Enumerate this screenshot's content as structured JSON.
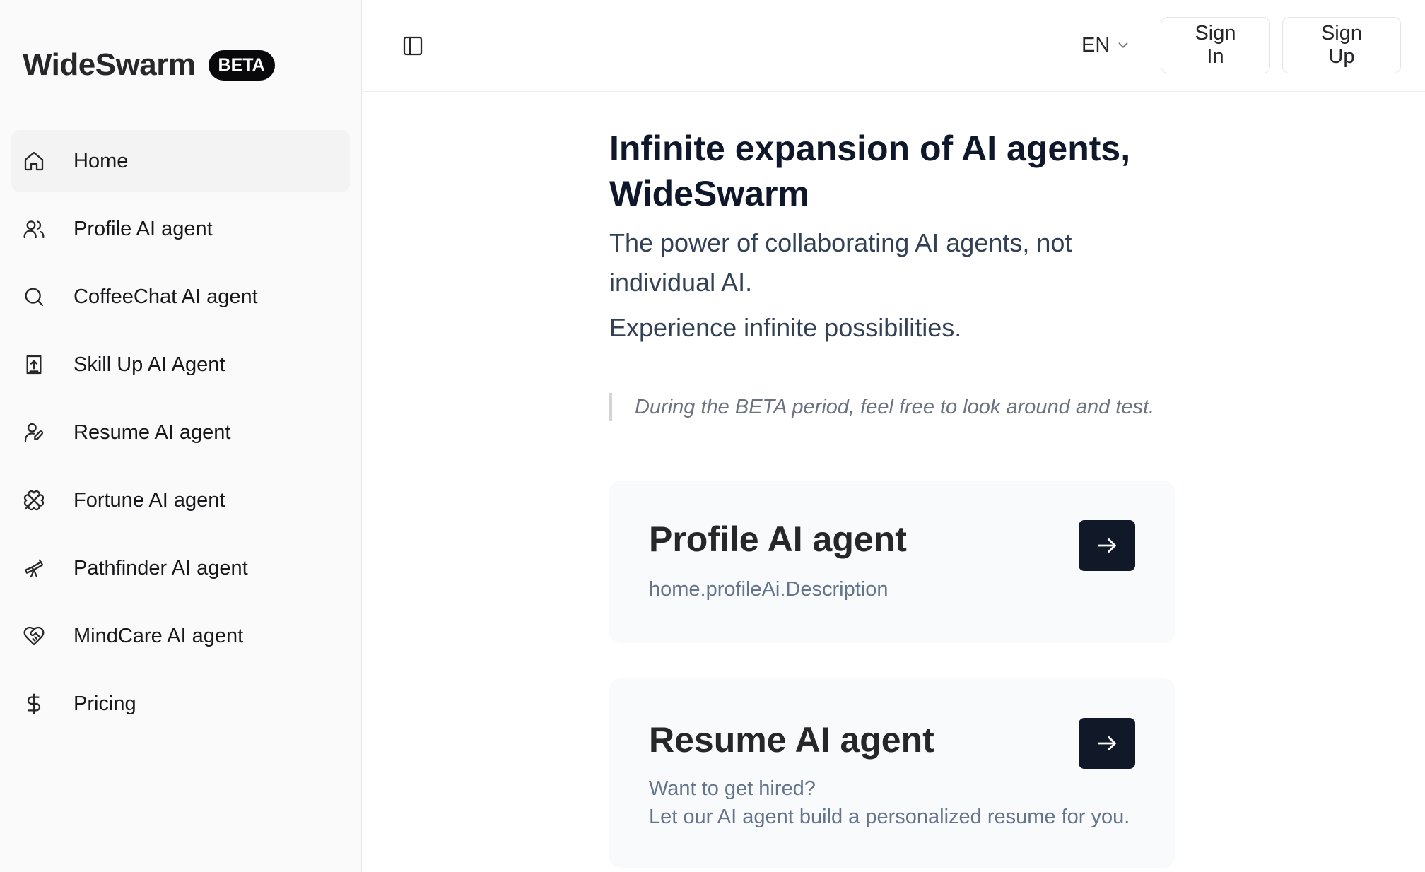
{
  "brand": {
    "name": "WideSwarm",
    "badge": "BETA"
  },
  "sidebar": {
    "items": [
      {
        "label": "Home",
        "icon": "home-icon",
        "active": true
      },
      {
        "label": "Profile AI agent",
        "icon": "users-icon"
      },
      {
        "label": "CoffeeChat AI agent",
        "icon": "search-icon"
      },
      {
        "label": "Skill Up AI Agent",
        "icon": "book-upload-icon"
      },
      {
        "label": "Resume AI agent",
        "icon": "user-pen-icon"
      },
      {
        "label": "Fortune AI agent",
        "icon": "clover-icon"
      },
      {
        "label": "Pathfinder AI agent",
        "icon": "telescope-icon"
      },
      {
        "label": "MindCare AI agent",
        "icon": "heart-handshake-icon"
      },
      {
        "label": "Pricing",
        "icon": "dollar-icon"
      }
    ]
  },
  "header": {
    "language": "EN",
    "sign_in": "Sign In",
    "sign_up": "Sign Up"
  },
  "hero": {
    "title": "Infinite expansion of AI agents, WideSwarm",
    "subtitle": "The power of collaborating AI agents, not individual AI.",
    "subtitle2": "Experience infinite possibilities.",
    "notice": "During the BETA period, feel free to look around and test."
  },
  "cards": [
    {
      "title": "Profile AI agent",
      "description": "home.profileAi.Description",
      "button_icon": "arrow-right-icon"
    },
    {
      "title": "Resume AI agent",
      "description_lines": [
        "Want to get hired?",
        "Let our AI agent build a personalized resume for you."
      ],
      "button_icon": "arrow-right-icon"
    }
  ],
  "colors": {
    "accent": "#111827",
    "badge_bg": "#09090b",
    "active_item_bg": "#f3f3f4",
    "card_bg": "#f8fafc"
  }
}
